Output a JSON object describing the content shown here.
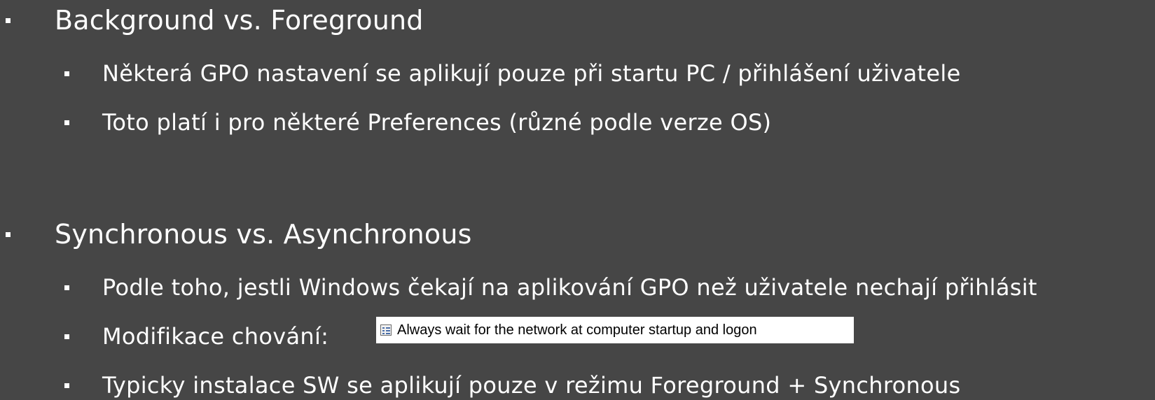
{
  "sections": [
    {
      "heading": "Background vs. Foreground",
      "items": [
        "Některá GPO nastavení se aplikují pouze při startu PC / přihlášení uživatele",
        "Toto platí i pro některé Preferences (různé podle verze OS)"
      ]
    },
    {
      "heading": "Synchronous vs. Asynchronous",
      "items": [
        "Podle toho, jestli Windows čekají na aplikování GPO než uživatele nechají přihlásit",
        "Modifikace chování:",
        "Typicky instalace SW se aplikují pouze v režimu Foreground + Synchronous"
      ]
    }
  ],
  "policy_setting": {
    "icon": "policy-setting-icon",
    "label": "Always wait for the network at computer startup and logon"
  },
  "colors": {
    "background": "#464646",
    "text": "#ffffff"
  }
}
